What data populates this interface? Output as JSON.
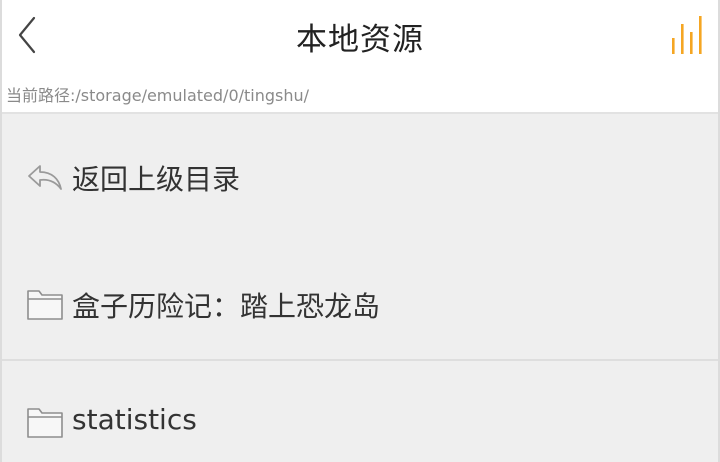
{
  "header": {
    "title": "本地资源",
    "back_icon": "chevron-left-icon",
    "playing_icon": "equalizer-bars-icon",
    "accent_color": "#f5a623"
  },
  "path_bar": {
    "text": "当前路径:/storage/emulated/0/tingshu/"
  },
  "list": {
    "items": [
      {
        "label": "返回上级目录",
        "icon": "return-arrow-icon",
        "type": "parent"
      },
      {
        "label": "盒子历险记：踏上恐龙岛",
        "icon": "folder-icon",
        "type": "folder"
      },
      {
        "label": "statistics",
        "icon": "folder-icon",
        "type": "folder"
      }
    ]
  },
  "colors": {
    "background": "#efefef",
    "header_background": "#ffffff",
    "divider": "#dedede",
    "text": "#333333",
    "path_text": "#8a8a8a"
  }
}
